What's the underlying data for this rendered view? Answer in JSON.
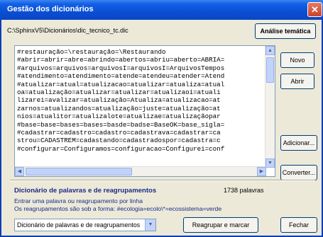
{
  "window": {
    "title": "Gestão dos dicionários"
  },
  "path": "C:\\SphinxV5\\Dicionários\\dic_tecnico_tc.dic",
  "buttons": {
    "analise": "Análise temática",
    "novo": "Novo",
    "abrir": "Abrir",
    "adicionar": "Adicionar...",
    "converter": "Converter...",
    "reagrupar": "Reagrupar e marcar",
    "fechar": "Fechar"
  },
  "editor": {
    "lines": [
      "#restauração=\\restauração=\\Restaurando",
      "#abrir=abrir=abre=abrindo=abertos=abriu=aberto=ABRIA=",
      "#arquivos=arquivos=arquivosI=arquivosI=ArquivosTempos",
      "#atendimento=atendimento=atende=atendeu=atender=Atend",
      "#atualizar=atual=atualizacao=atualizar=atualiza=atual",
      "oa=atualização=atualizar=atualizar=atualizaoi=atuali",
      "lizarei=avalizar=atualização=Atualiza=atualizacao=at",
      "zarnos=atualizandos=atualização=juste=atualização=at",
      "nios=atualitor=atualizalote=atualizae=atualizaçãopar",
      "#base=base=bases=bases=basde=badse=BaseOK=base_sigla=",
      "#cadastrar=cadastro=cadastro=cadastrava=cadastrar=ca",
      "strou=CADASTREM=cadastando=cadastradospor=cadastra=c",
      "#configurar=Configuramos=configuracao=Configurei=conf"
    ]
  },
  "info": {
    "title": "Dicionário de palavras e de reagrupamentos",
    "count": "1738 palavras",
    "line1": "Entrar uma palavra ou reagrupamento por linha",
    "line2": "Os reagrupamentos são sob a forma: #ecologia=ecolo\\*=ecossistema=verde"
  },
  "select": {
    "value": "Dicionário de palavras e de reagrupamentos"
  }
}
